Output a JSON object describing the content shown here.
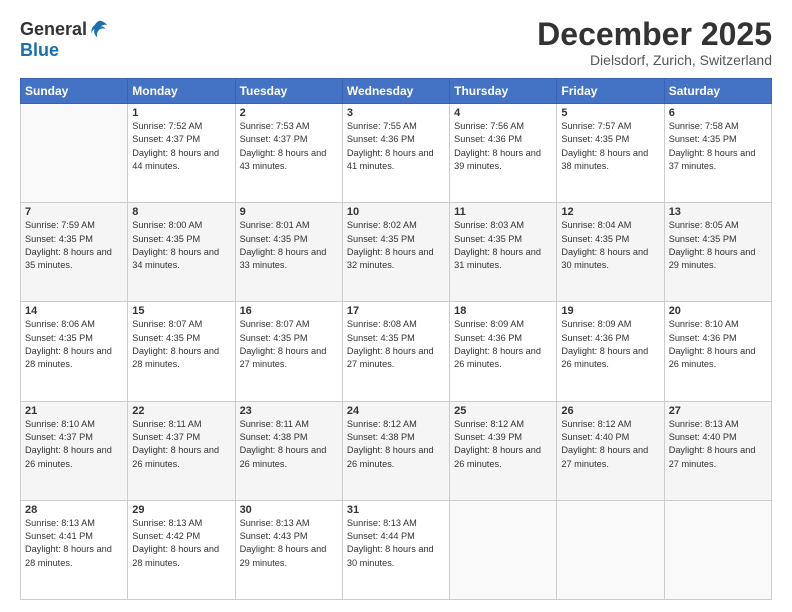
{
  "header": {
    "logo_general": "General",
    "logo_blue": "Blue",
    "month_title": "December 2025",
    "location": "Dielsdorf, Zurich, Switzerland"
  },
  "weekdays": [
    "Sunday",
    "Monday",
    "Tuesday",
    "Wednesday",
    "Thursday",
    "Friday",
    "Saturday"
  ],
  "weeks": [
    [
      {
        "day": "",
        "sunrise": "",
        "sunset": "",
        "daylight": ""
      },
      {
        "day": "1",
        "sunrise": "Sunrise: 7:52 AM",
        "sunset": "Sunset: 4:37 PM",
        "daylight": "Daylight: 8 hours and 44 minutes."
      },
      {
        "day": "2",
        "sunrise": "Sunrise: 7:53 AM",
        "sunset": "Sunset: 4:37 PM",
        "daylight": "Daylight: 8 hours and 43 minutes."
      },
      {
        "day": "3",
        "sunrise": "Sunrise: 7:55 AM",
        "sunset": "Sunset: 4:36 PM",
        "daylight": "Daylight: 8 hours and 41 minutes."
      },
      {
        "day": "4",
        "sunrise": "Sunrise: 7:56 AM",
        "sunset": "Sunset: 4:36 PM",
        "daylight": "Daylight: 8 hours and 39 minutes."
      },
      {
        "day": "5",
        "sunrise": "Sunrise: 7:57 AM",
        "sunset": "Sunset: 4:35 PM",
        "daylight": "Daylight: 8 hours and 38 minutes."
      },
      {
        "day": "6",
        "sunrise": "Sunrise: 7:58 AM",
        "sunset": "Sunset: 4:35 PM",
        "daylight": "Daylight: 8 hours and 37 minutes."
      }
    ],
    [
      {
        "day": "7",
        "sunrise": "Sunrise: 7:59 AM",
        "sunset": "Sunset: 4:35 PM",
        "daylight": "Daylight: 8 hours and 35 minutes."
      },
      {
        "day": "8",
        "sunrise": "Sunrise: 8:00 AM",
        "sunset": "Sunset: 4:35 PM",
        "daylight": "Daylight: 8 hours and 34 minutes."
      },
      {
        "day": "9",
        "sunrise": "Sunrise: 8:01 AM",
        "sunset": "Sunset: 4:35 PM",
        "daylight": "Daylight: 8 hours and 33 minutes."
      },
      {
        "day": "10",
        "sunrise": "Sunrise: 8:02 AM",
        "sunset": "Sunset: 4:35 PM",
        "daylight": "Daylight: 8 hours and 32 minutes."
      },
      {
        "day": "11",
        "sunrise": "Sunrise: 8:03 AM",
        "sunset": "Sunset: 4:35 PM",
        "daylight": "Daylight: 8 hours and 31 minutes."
      },
      {
        "day": "12",
        "sunrise": "Sunrise: 8:04 AM",
        "sunset": "Sunset: 4:35 PM",
        "daylight": "Daylight: 8 hours and 30 minutes."
      },
      {
        "day": "13",
        "sunrise": "Sunrise: 8:05 AM",
        "sunset": "Sunset: 4:35 PM",
        "daylight": "Daylight: 8 hours and 29 minutes."
      }
    ],
    [
      {
        "day": "14",
        "sunrise": "Sunrise: 8:06 AM",
        "sunset": "Sunset: 4:35 PM",
        "daylight": "Daylight: 8 hours and 28 minutes."
      },
      {
        "day": "15",
        "sunrise": "Sunrise: 8:07 AM",
        "sunset": "Sunset: 4:35 PM",
        "daylight": "Daylight: 8 hours and 28 minutes."
      },
      {
        "day": "16",
        "sunrise": "Sunrise: 8:07 AM",
        "sunset": "Sunset: 4:35 PM",
        "daylight": "Daylight: 8 hours and 27 minutes."
      },
      {
        "day": "17",
        "sunrise": "Sunrise: 8:08 AM",
        "sunset": "Sunset: 4:35 PM",
        "daylight": "Daylight: 8 hours and 27 minutes."
      },
      {
        "day": "18",
        "sunrise": "Sunrise: 8:09 AM",
        "sunset": "Sunset: 4:36 PM",
        "daylight": "Daylight: 8 hours and 26 minutes."
      },
      {
        "day": "19",
        "sunrise": "Sunrise: 8:09 AM",
        "sunset": "Sunset: 4:36 PM",
        "daylight": "Daylight: 8 hours and 26 minutes."
      },
      {
        "day": "20",
        "sunrise": "Sunrise: 8:10 AM",
        "sunset": "Sunset: 4:36 PM",
        "daylight": "Daylight: 8 hours and 26 minutes."
      }
    ],
    [
      {
        "day": "21",
        "sunrise": "Sunrise: 8:10 AM",
        "sunset": "Sunset: 4:37 PM",
        "daylight": "Daylight: 8 hours and 26 minutes."
      },
      {
        "day": "22",
        "sunrise": "Sunrise: 8:11 AM",
        "sunset": "Sunset: 4:37 PM",
        "daylight": "Daylight: 8 hours and 26 minutes."
      },
      {
        "day": "23",
        "sunrise": "Sunrise: 8:11 AM",
        "sunset": "Sunset: 4:38 PM",
        "daylight": "Daylight: 8 hours and 26 minutes."
      },
      {
        "day": "24",
        "sunrise": "Sunrise: 8:12 AM",
        "sunset": "Sunset: 4:38 PM",
        "daylight": "Daylight: 8 hours and 26 minutes."
      },
      {
        "day": "25",
        "sunrise": "Sunrise: 8:12 AM",
        "sunset": "Sunset: 4:39 PM",
        "daylight": "Daylight: 8 hours and 26 minutes."
      },
      {
        "day": "26",
        "sunrise": "Sunrise: 8:12 AM",
        "sunset": "Sunset: 4:40 PM",
        "daylight": "Daylight: 8 hours and 27 minutes."
      },
      {
        "day": "27",
        "sunrise": "Sunrise: 8:13 AM",
        "sunset": "Sunset: 4:40 PM",
        "daylight": "Daylight: 8 hours and 27 minutes."
      }
    ],
    [
      {
        "day": "28",
        "sunrise": "Sunrise: 8:13 AM",
        "sunset": "Sunset: 4:41 PM",
        "daylight": "Daylight: 8 hours and 28 minutes."
      },
      {
        "day": "29",
        "sunrise": "Sunrise: 8:13 AM",
        "sunset": "Sunset: 4:42 PM",
        "daylight": "Daylight: 8 hours and 28 minutes."
      },
      {
        "day": "30",
        "sunrise": "Sunrise: 8:13 AM",
        "sunset": "Sunset: 4:43 PM",
        "daylight": "Daylight: 8 hours and 29 minutes."
      },
      {
        "day": "31",
        "sunrise": "Sunrise: 8:13 AM",
        "sunset": "Sunset: 4:44 PM",
        "daylight": "Daylight: 8 hours and 30 minutes."
      },
      {
        "day": "",
        "sunrise": "",
        "sunset": "",
        "daylight": ""
      },
      {
        "day": "",
        "sunrise": "",
        "sunset": "",
        "daylight": ""
      },
      {
        "day": "",
        "sunrise": "",
        "sunset": "",
        "daylight": ""
      }
    ]
  ]
}
